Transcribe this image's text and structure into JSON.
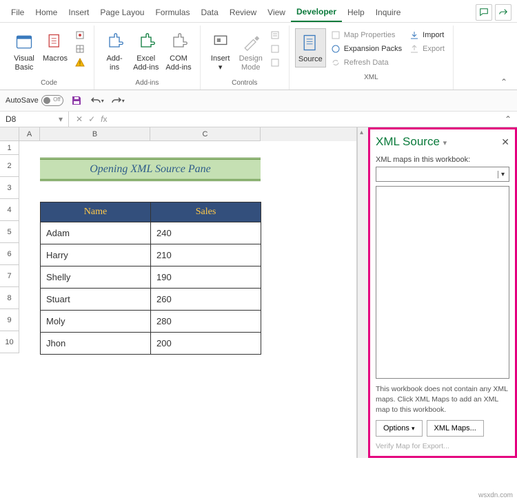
{
  "tabs": [
    "File",
    "Home",
    "Insert",
    "Page Layou",
    "Formulas",
    "Data",
    "Review",
    "View",
    "Developer",
    "Help",
    "Inquire"
  ],
  "active_tab": "Developer",
  "ribbon": {
    "code": {
      "label": "Code",
      "visual_basic": "Visual\nBasic",
      "macros": "Macros"
    },
    "addins": {
      "label": "Add-ins",
      "addins": "Add-\nins",
      "excel": "Excel\nAdd-ins",
      "com": "COM\nAdd-ins"
    },
    "controls": {
      "label": "Controls",
      "insert": "Insert",
      "design": "Design\nMode"
    },
    "xml": {
      "label": "XML",
      "source": "Source",
      "map_props": "Map Properties",
      "expansion": "Expansion Packs",
      "refresh": "Refresh Data",
      "import": "Import",
      "export": "Export"
    }
  },
  "qat": {
    "autosave": "AutoSave",
    "off": "Off"
  },
  "name_box": "D8",
  "columns": [
    "A",
    "B",
    "C"
  ],
  "rows": [
    "1",
    "2",
    "3",
    "4",
    "5",
    "6",
    "7",
    "8",
    "9",
    "10"
  ],
  "title_cell": "Opening XML Source Pane",
  "table": {
    "headers": [
      "Name",
      "Sales"
    ],
    "rows": [
      [
        "Adam",
        "240"
      ],
      [
        "Harry",
        "210"
      ],
      [
        "Shelly",
        "190"
      ],
      [
        "Stuart",
        "260"
      ],
      [
        "Moly",
        "280"
      ],
      [
        "Jhon",
        "200"
      ]
    ]
  },
  "xml_pane": {
    "title": "XML Source",
    "maps_label": "XML maps in this workbook:",
    "msg": "This workbook does not contain any XML maps. Click XML Maps to add an XML map to this workbook.",
    "options": "Options",
    "xml_maps": "XML Maps...",
    "verify": "Verify Map for Export..."
  },
  "watermark": "wsxdn.com",
  "chart_data": {
    "type": "table",
    "title": "Opening XML Source Pane",
    "columns": [
      "Name",
      "Sales"
    ],
    "rows": [
      {
        "Name": "Adam",
        "Sales": 240
      },
      {
        "Name": "Harry",
        "Sales": 210
      },
      {
        "Name": "Shelly",
        "Sales": 190
      },
      {
        "Name": "Stuart",
        "Sales": 260
      },
      {
        "Name": "Moly",
        "Sales": 280
      },
      {
        "Name": "Jhon",
        "Sales": 200
      }
    ]
  }
}
